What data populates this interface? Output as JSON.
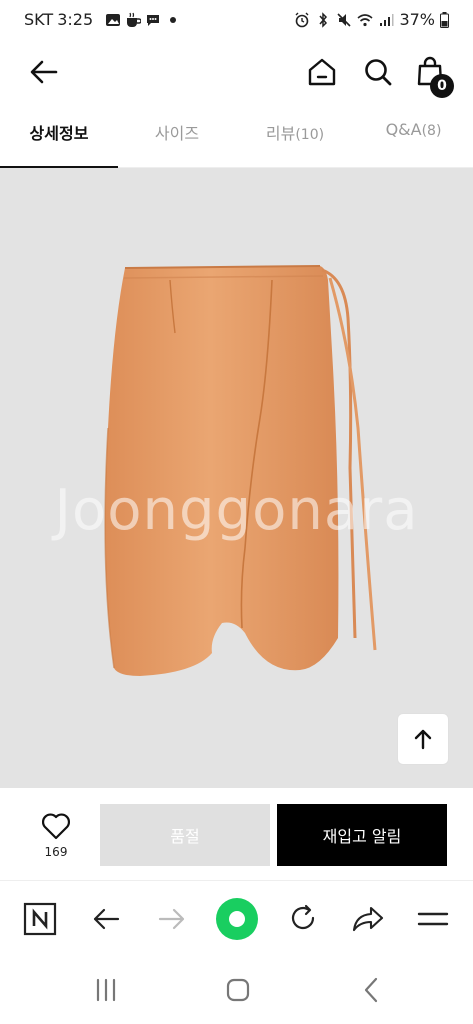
{
  "status_bar": {
    "carrier": "SKT",
    "time": "3:25",
    "battery": "37%"
  },
  "header": {
    "back_icon": "arrow-left-icon",
    "home_icon": "home-icon",
    "search_icon": "search-icon",
    "cart_icon": "shopping-bag-icon",
    "cart_count": "0"
  },
  "tabs": [
    {
      "label": "상세정보",
      "count": "",
      "active": true
    },
    {
      "label": "사이즈",
      "count": "",
      "active": false
    },
    {
      "label": "리뷰",
      "count": "(10)",
      "active": false
    },
    {
      "label": "Q&A",
      "count": "(8)",
      "active": false
    }
  ],
  "product": {
    "watermark": "Joonggonara",
    "image_desc_icon": "orange-leather-wrap-skirt",
    "background": "#e3e3e3",
    "skirt_color": "#e49a66"
  },
  "actions": {
    "like_count": "169",
    "soldout_label": "품절",
    "restock_label": "재입고 알림"
  },
  "browser_bar": {
    "items": [
      "naver-n-icon",
      "back-arrow-icon",
      "forward-arrow-icon",
      "green-circle-icon",
      "refresh-icon",
      "share-icon",
      "menu-icon"
    ]
  },
  "nav_bar": {
    "items": [
      "recent-apps-icon",
      "home-button-icon",
      "back-chevron-icon"
    ]
  }
}
